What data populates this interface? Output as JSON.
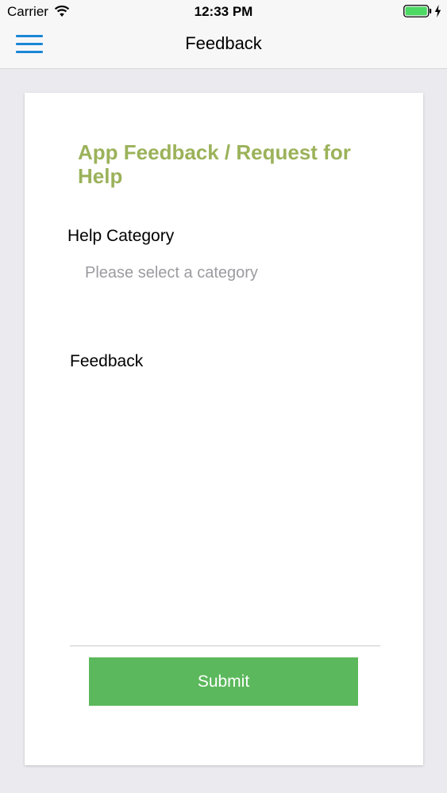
{
  "status_bar": {
    "carrier": "Carrier",
    "time": "12:33 PM",
    "battery_color": "#4cd964"
  },
  "nav": {
    "title": "Feedback",
    "menu_icon": "hamburger-menu-icon",
    "accent_color": "#1a86d6"
  },
  "form": {
    "title": "App Feedback / Request for Help",
    "title_color": "#9bb25a",
    "help_category_label": "Help Category",
    "category_placeholder": "Please select a category",
    "feedback_label": "Feedback",
    "submit_label": "Submit",
    "submit_color": "#5cb85c"
  }
}
